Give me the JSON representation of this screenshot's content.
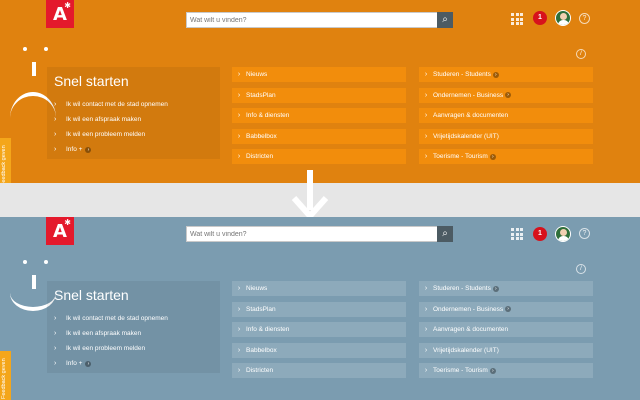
{
  "header": {
    "logo_text": "A",
    "search_placeholder": "Wat wilt u vinden?",
    "notification_count": "1",
    "help_label": "?",
    "edit_label": "/"
  },
  "quick_start": {
    "title": "Snel starten",
    "items": [
      {
        "label": "Ik wil contact met de stad opnemen"
      },
      {
        "label": "Ik wil een afspraak maken"
      },
      {
        "label": "Ik wil een probleem melden"
      },
      {
        "label": "Info +"
      }
    ]
  },
  "tiles_middle": [
    {
      "label": "Nieuws"
    },
    {
      "label": "StadsPlan"
    },
    {
      "label": "Info & diensten"
    },
    {
      "label": "Babbelbox"
    },
    {
      "label": "Districten"
    }
  ],
  "tiles_right": [
    {
      "label": "Studeren - Students"
    },
    {
      "label": "Ondernemen - Business"
    },
    {
      "label": "Aanvragen & documenten"
    },
    {
      "label": "Vrijetijdskalender (UIT)"
    },
    {
      "label": "Toerisme - Tourism"
    }
  ],
  "feedback_tab": "Feedback geven",
  "icons": {
    "logo": "a-logo-icon",
    "search": "search-icon",
    "apps": "apps-grid-icon",
    "avatar": "avatar-icon",
    "help": "help-icon",
    "edit": "edit-icon",
    "arrow": "chevron-right-icon",
    "divider": "arrow-down-icon",
    "mood_sad": "sad-face-icon",
    "mood_happy": "happy-face-icon"
  },
  "colors": {
    "top_background": "#e0820f",
    "top_tile": "#f28d0c",
    "bottom_background": "#7b9cb0",
    "logo_red": "#e4192c",
    "badge_red": "#d7121c"
  }
}
